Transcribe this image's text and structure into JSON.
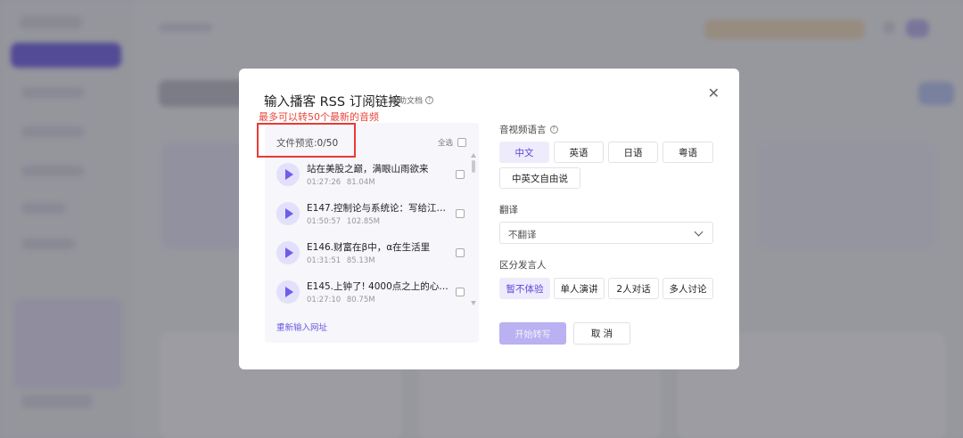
{
  "modal": {
    "title": "输入播客 RSS 订阅链接",
    "help_label": "帮助文档",
    "close_glyph": "✕",
    "annotation": "最多可以转50个最新的音频"
  },
  "preview": {
    "label": "文件预览:",
    "count": "0/50",
    "select_all": "全选",
    "reenter_url": "重新输入网址",
    "episodes": [
      {
        "title": "站在美股之巅，满眼山雨欲来",
        "duration": "01:27:26",
        "size": "81.04M"
      },
      {
        "title": "E147.控制论与系统论：写给江湖…",
        "duration": "01:50:57",
        "size": "102.85M"
      },
      {
        "title": "E146.财富在β中，α在生活里",
        "duration": "01:31:51",
        "size": "85.13M"
      },
      {
        "title": "E145.上钟了! 4000点之上的心理…",
        "duration": "01:27:10",
        "size": "80.75M"
      }
    ]
  },
  "language": {
    "label": "音视频语言",
    "options": [
      "中文",
      "英语",
      "日语",
      "粤语",
      "中英文自由说"
    ],
    "selected": "中文"
  },
  "translate": {
    "label": "翻译",
    "value": "不翻译"
  },
  "speakers": {
    "label": "区分发言人",
    "options": [
      "暂不体验",
      "单人演讲",
      "2人对话",
      "多人讨论"
    ],
    "selected": "暂不体验"
  },
  "actions": {
    "start": "开始转写",
    "cancel": "取 消"
  },
  "colors": {
    "accent": "#6a58e3",
    "annotation": "#e8463c"
  }
}
